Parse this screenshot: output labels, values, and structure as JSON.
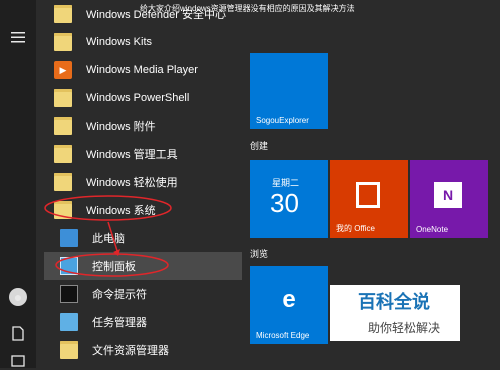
{
  "caption": "给大家介绍windows资源管理器没有相应的原因及其解决方法",
  "app_list": [
    {
      "label": "Windows Defender 安全中心",
      "icon": "folder-icon"
    },
    {
      "label": "Windows Kits",
      "icon": "folder-icon"
    },
    {
      "label": "Windows Media Player",
      "icon": "media-player-icon"
    },
    {
      "label": "Windows PowerShell",
      "icon": "folder-icon"
    },
    {
      "label": "Windows 附件",
      "icon": "folder-icon"
    },
    {
      "label": "Windows 管理工具",
      "icon": "folder-icon"
    },
    {
      "label": "Windows 轻松使用",
      "icon": "folder-icon"
    },
    {
      "label": "Windows 系统",
      "icon": "folder-icon"
    },
    {
      "label": "此电脑",
      "icon": "computer-icon"
    },
    {
      "label": "控制面板",
      "icon": "control-panel-icon"
    },
    {
      "label": "命令提示符",
      "icon": "command-prompt-icon"
    },
    {
      "label": "任务管理器",
      "icon": "task-manager-icon"
    },
    {
      "label": "文件资源管理器",
      "icon": "file-explorer-icon"
    }
  ],
  "tiles": {
    "sogou": "SogouExplorer",
    "group_create": "创建",
    "calendar_day": "星期二",
    "calendar_date": "30",
    "office": "我的 Office",
    "onenote": "OneNote",
    "group_browse": "浏览",
    "edge": "Microsoft Edge"
  },
  "watermark": {
    "title": "百科全说",
    "subtitle": "助你轻松解决"
  },
  "colors": {
    "tile_blue": "#0078d7",
    "office_orange": "#d83b01",
    "onenote_purple": "#7719aa",
    "annotation_red": "#e0262a"
  }
}
